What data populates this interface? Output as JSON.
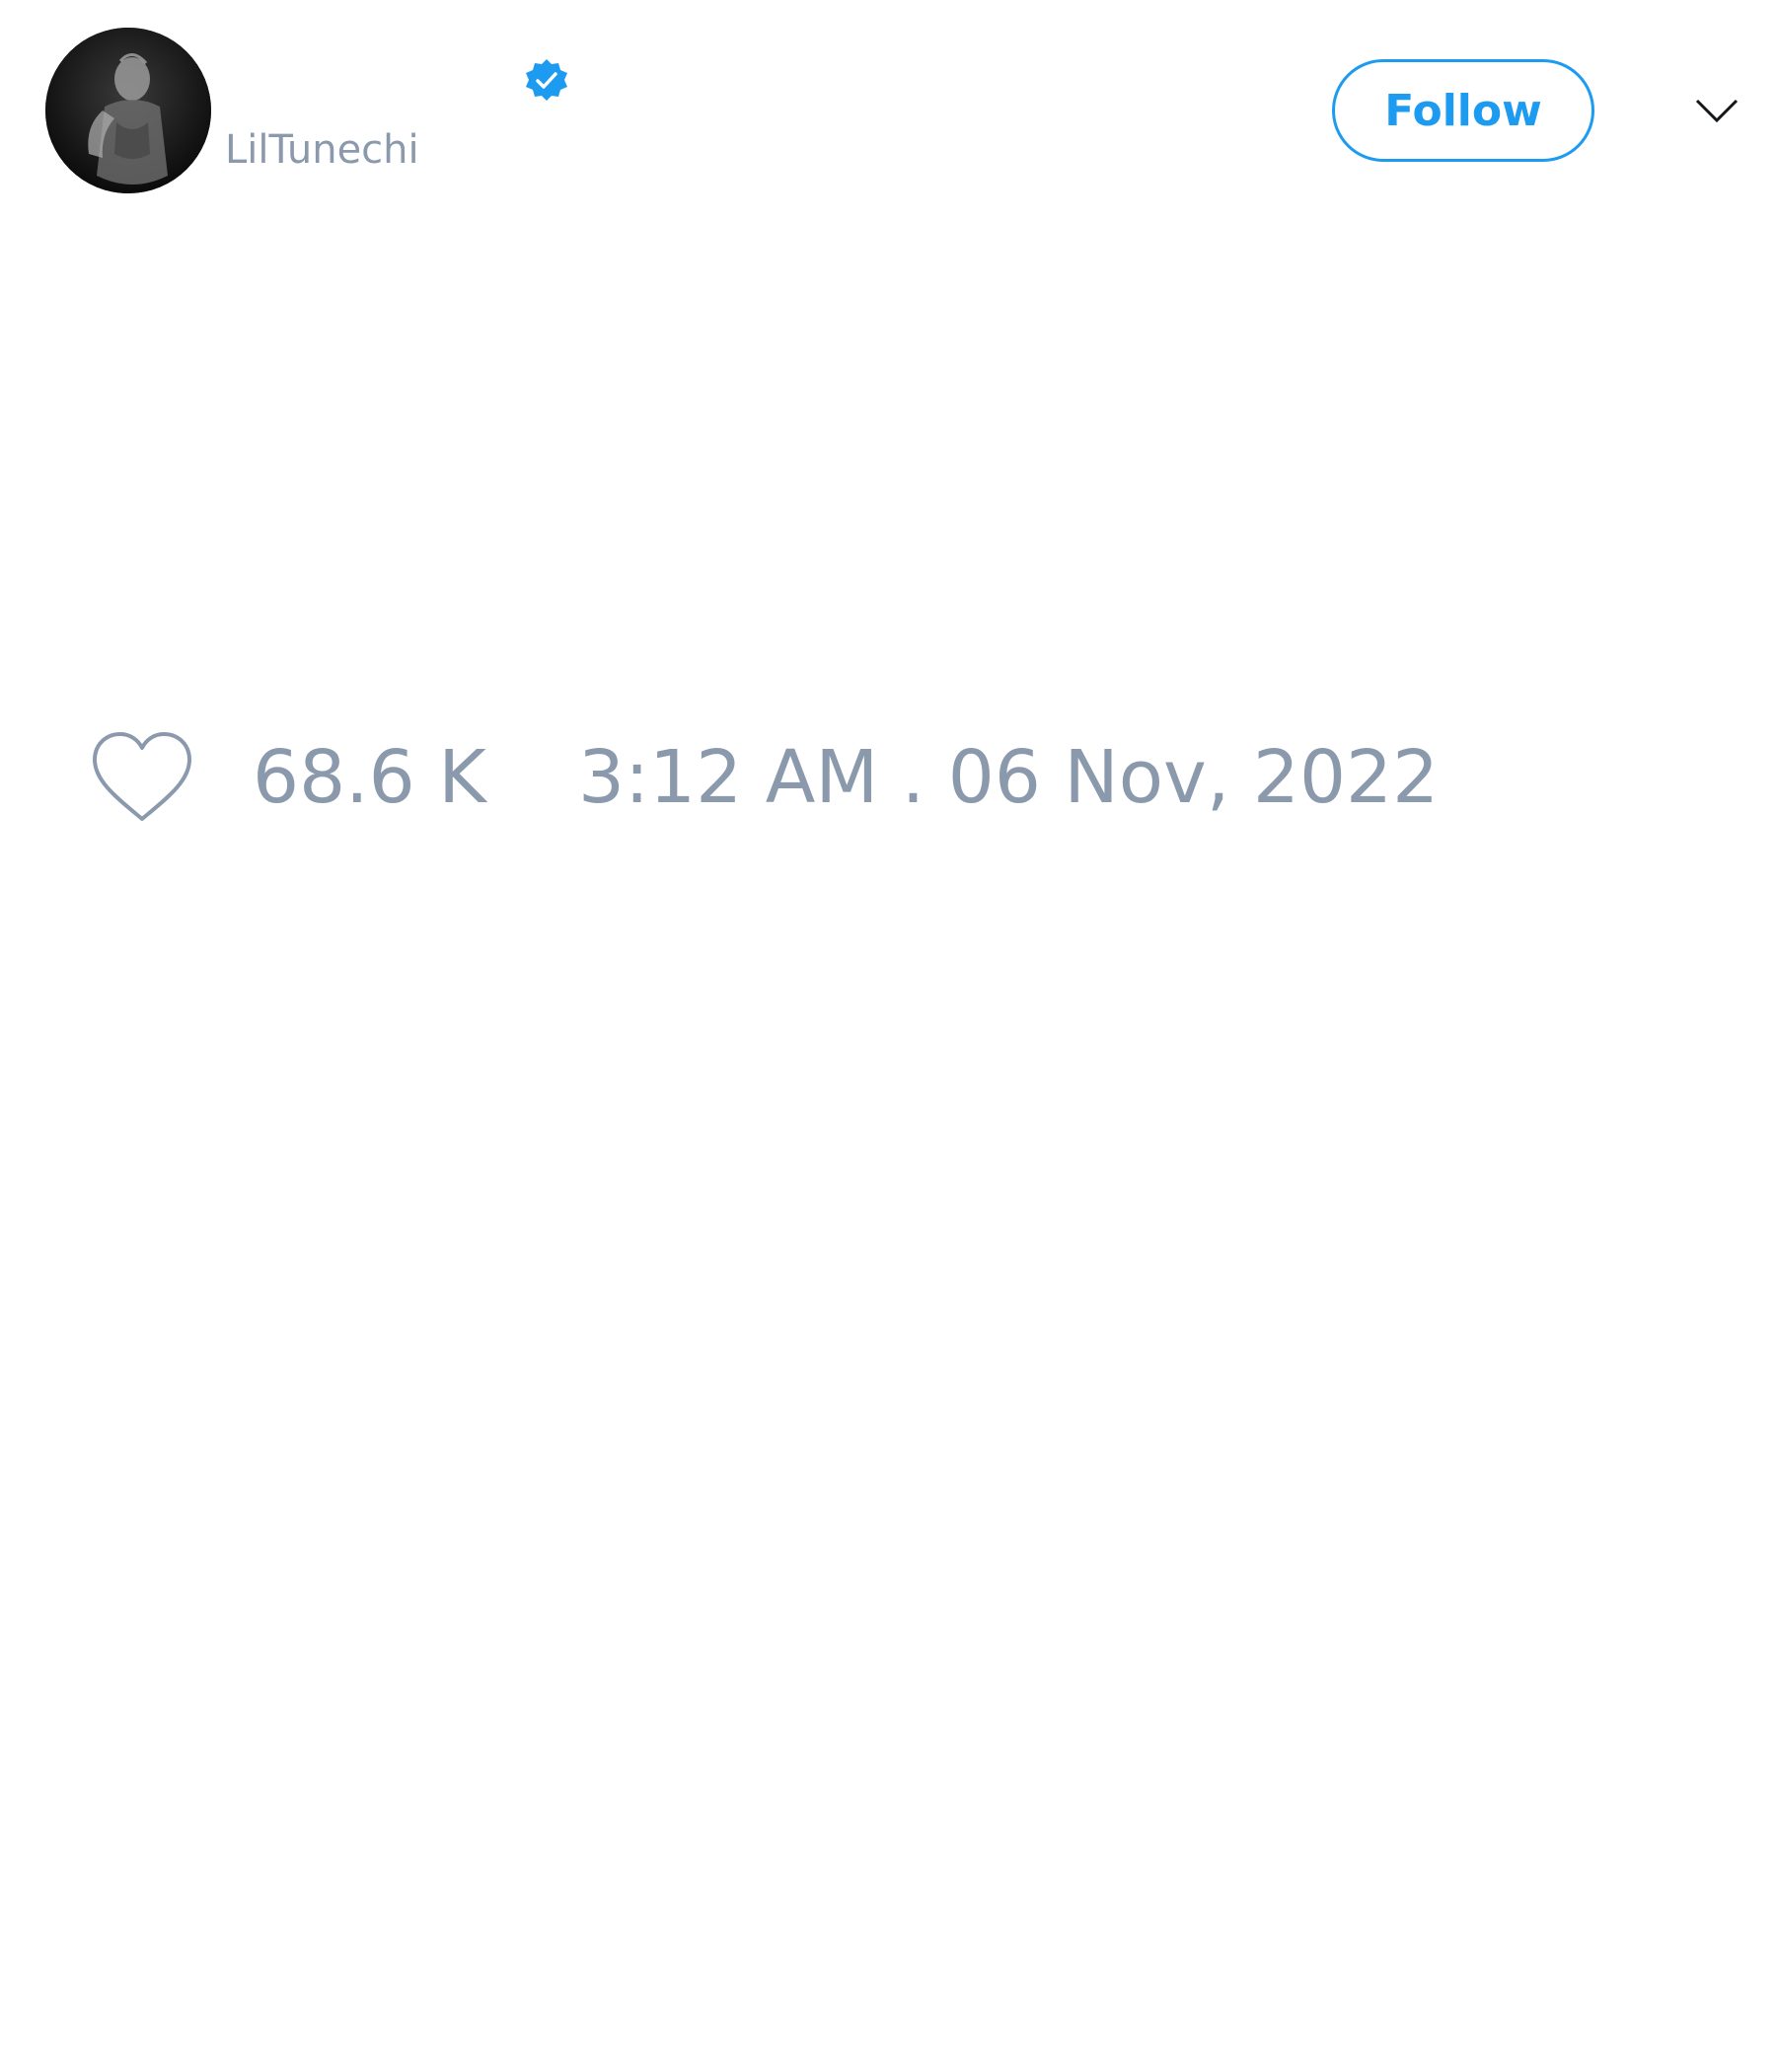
{
  "tweet": {
    "author": {
      "display_name": "",
      "handle": "LilTunechi",
      "verified": true,
      "avatar_icon": "avatar-photo"
    },
    "follow_label": "Follow",
    "menu_icon": "chevron-down-icon",
    "text": "",
    "likes": {
      "icon": "heart-icon",
      "count": "68.6 K"
    },
    "timestamp": "3:12 AM . 06 Nov, 2022"
  },
  "colors": {
    "accent": "#1d9bf0",
    "muted_text": "#8b99ac",
    "background": "#ffffff"
  }
}
